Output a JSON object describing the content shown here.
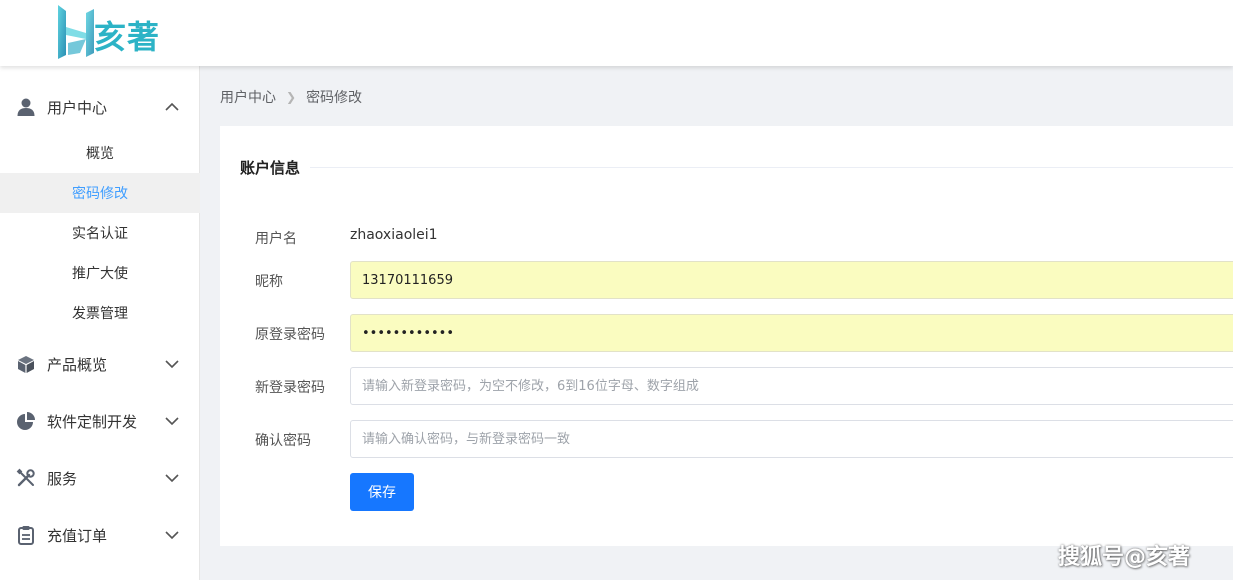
{
  "brand": {
    "logo_text": "亥著",
    "accent_color": "#2cb3c6"
  },
  "sidebar": {
    "groups": [
      {
        "label": "用户中心",
        "icon": "user-icon",
        "expanded": true,
        "items": [
          {
            "label": "概览"
          },
          {
            "label": "密码修改",
            "active": true
          },
          {
            "label": "实名认证"
          },
          {
            "label": "推广大使"
          },
          {
            "label": "发票管理"
          }
        ]
      },
      {
        "label": "产品概览",
        "icon": "cube-icon",
        "expanded": false
      },
      {
        "label": "软件定制开发",
        "icon": "pie-chart-icon",
        "expanded": false
      },
      {
        "label": "服务",
        "icon": "tools-icon",
        "expanded": false
      },
      {
        "label": "充值订单",
        "icon": "clipboard-icon",
        "expanded": false
      }
    ]
  },
  "breadcrumb": {
    "parent": "用户中心",
    "current": "密码修改"
  },
  "form": {
    "section_title": "账户信息",
    "username": {
      "label": "用户名",
      "value": "zhaoxiaolei1"
    },
    "nickname": {
      "label": "昵称",
      "value": "13170111659"
    },
    "old_password": {
      "label": "原登录密码",
      "value": "••••••••••••"
    },
    "new_password": {
      "label": "新登录密码",
      "placeholder": "请输入新登录密码，为空不修改，6到16位字母、数字组成"
    },
    "confirm_password": {
      "label": "确认密码",
      "placeholder": "请输入确认密码，与新登录密码一致"
    },
    "save_label": "保存",
    "button_color": "#1677ff"
  },
  "watermark": "搜狐号@亥著"
}
